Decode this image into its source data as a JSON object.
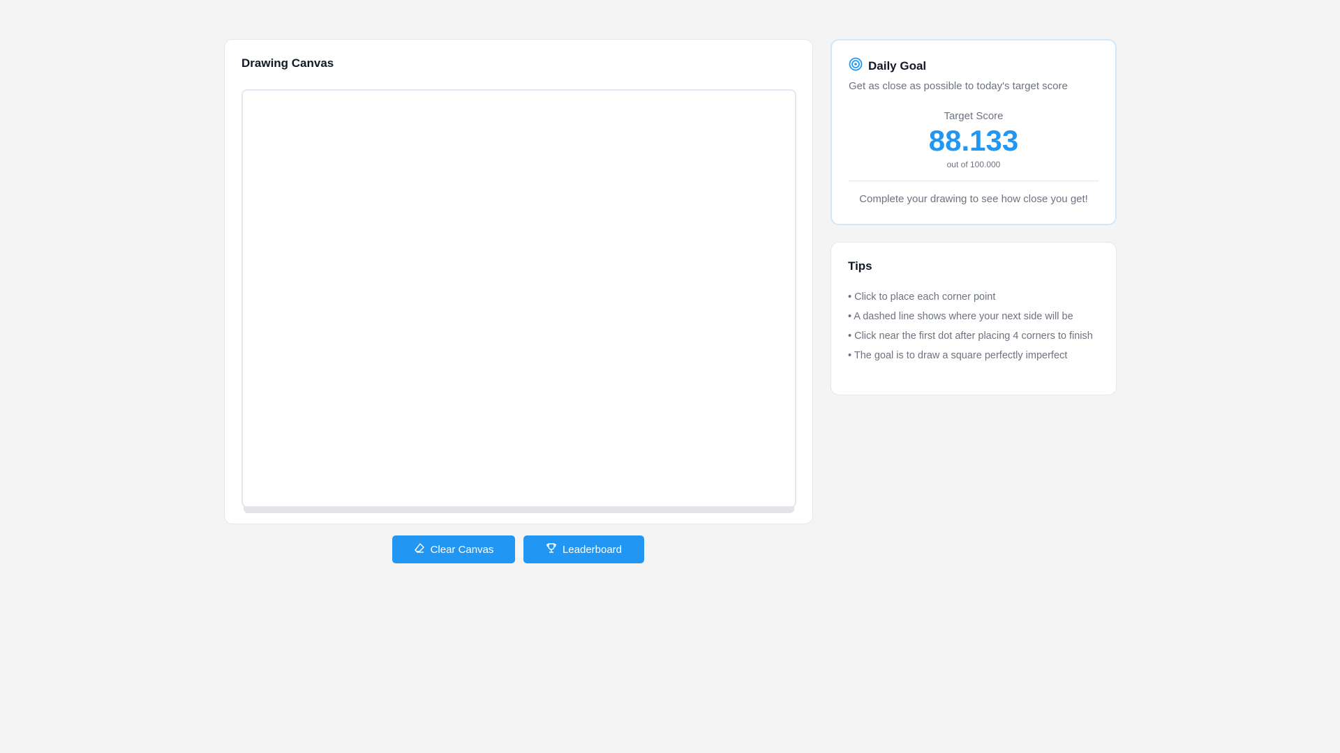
{
  "canvas_card": {
    "title": "Drawing Canvas"
  },
  "goal": {
    "title": "Daily Goal",
    "subtitle": "Get as close as possible to today's target score",
    "target_label": "Target Score",
    "target_score": "88.133",
    "out_of": "out of 100.000",
    "message": "Complete your drawing to see how close you get!",
    "accent": "#2196f3"
  },
  "tips": {
    "title": "Tips",
    "items": [
      "• Click to place each corner point",
      "• A dashed line shows where your next side will be",
      "• Click near the first dot after placing 4 corners to finish",
      "• The goal is to draw a square perfectly imperfect"
    ]
  },
  "buttons": {
    "clear": "Clear Canvas",
    "leaderboard": "Leaderboard"
  }
}
